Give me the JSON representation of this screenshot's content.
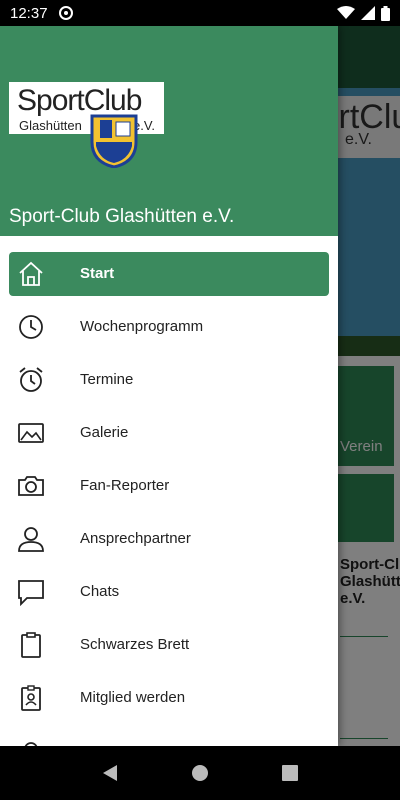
{
  "status": {
    "time": "12:37"
  },
  "background": {
    "logo_title": "SportClub",
    "logo_sub": "e.V.",
    "tile_label": "Verein",
    "club_name": "Sport-Club Glashütten e.V."
  },
  "drawer": {
    "logo_title": "SportClub",
    "logo_place": "Glashütten",
    "logo_suffix": "e.V.",
    "title": "Sport-Club Glashütten e.V.",
    "items": [
      {
        "label": "Start",
        "icon": "home-icon"
      },
      {
        "label": "Wochenprogramm",
        "icon": "clock-icon"
      },
      {
        "label": "Termine",
        "icon": "alarm-clock-icon"
      },
      {
        "label": "Galerie",
        "icon": "image-icon"
      },
      {
        "label": "Fan-Reporter",
        "icon": "camera-icon"
      },
      {
        "label": "Ansprechpartner",
        "icon": "person-icon"
      },
      {
        "label": "Chats",
        "icon": "chat-icon"
      },
      {
        "label": "Schwarzes Brett",
        "icon": "clipboard-icon"
      },
      {
        "label": "Mitglied werden",
        "icon": "badge-icon"
      }
    ],
    "active_index": 0
  },
  "colors": {
    "primary_green": "#3b8a5e",
    "dark_green": "#1f5a3a"
  }
}
